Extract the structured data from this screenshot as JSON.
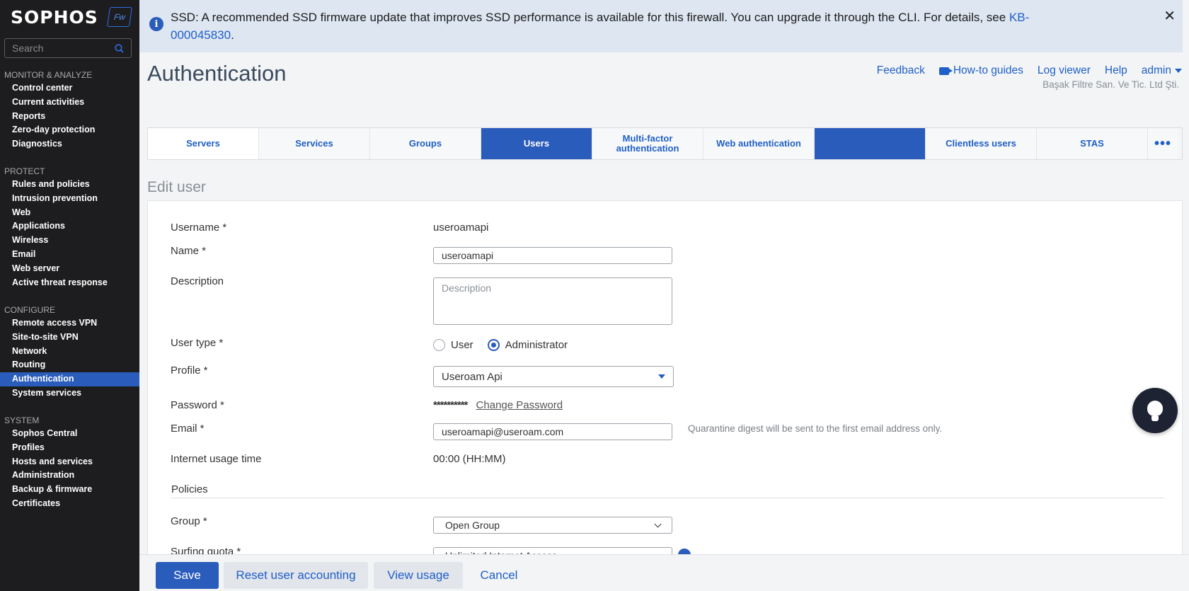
{
  "app": {
    "logo_text": "SOPHOS",
    "logo_badge": "Fw"
  },
  "sidebar": {
    "search_placeholder": "Search",
    "sections": [
      {
        "heading": "MONITOR & ANALYZE",
        "items": [
          "Control center",
          "Current activities",
          "Reports",
          "Zero-day protection",
          "Diagnostics"
        ]
      },
      {
        "heading": "PROTECT",
        "items": [
          "Rules and policies",
          "Intrusion prevention",
          "Web",
          "Applications",
          "Wireless",
          "Email",
          "Web server",
          "Active threat response"
        ]
      },
      {
        "heading": "CONFIGURE",
        "items": [
          "Remote access VPN",
          "Site-to-site VPN",
          "Network",
          "Routing",
          "Authentication",
          "System services"
        ]
      },
      {
        "heading": "SYSTEM",
        "items": [
          "Sophos Central",
          "Profiles",
          "Hosts and services",
          "Administration",
          "Backup & firmware",
          "Certificates"
        ]
      }
    ],
    "active_item": "Authentication"
  },
  "banner": {
    "text": "SSD: A recommended SSD firmware update that improves SSD performance is available for this firewall. You can upgrade it through the CLI. For details, see ",
    "link_text": "KB-000045830",
    "suffix": "."
  },
  "header": {
    "title": "Authentication",
    "links": {
      "feedback": "Feedback",
      "howto": "How-to guides",
      "logviewer": "Log viewer",
      "help": "Help",
      "admin": "admin"
    },
    "org_name": "Başak Filtre San. Ve Tic. Ltd Şti."
  },
  "tabs": [
    {
      "label": "Servers",
      "active": false
    },
    {
      "label": "Services",
      "active": false
    },
    {
      "label": "Groups",
      "active": false
    },
    {
      "label": "Users",
      "active": true
    },
    {
      "label": "Multi-factor authentication",
      "active": false
    },
    {
      "label": "Web authentication",
      "active": false
    },
    {
      "label": "",
      "active": true
    },
    {
      "label": "Clientless users",
      "active": false
    },
    {
      "label": "STAS",
      "active": false
    }
  ],
  "tabs_more": "•••",
  "form": {
    "section_title": "Edit user",
    "username_label": "Username *",
    "username_value": "useroamapi",
    "name_label": "Name *",
    "name_value": "useroamapi",
    "description_label": "Description",
    "description_placeholder": "Description",
    "usertype_label": "User type *",
    "usertype_options": [
      "User",
      "Administrator"
    ],
    "usertype_selected": "Administrator",
    "profile_label": "Profile *",
    "profile_value": "Useroam Api",
    "password_label": "Password *",
    "password_mask": "**********",
    "change_password": "Change Password",
    "email_label": "Email *",
    "email_value": "useroamapi@useroam.com",
    "email_hint": "Quarantine digest will be sent to the first email address only.",
    "internet_label": "Internet usage time",
    "internet_value": "00:00 (HH:MM)",
    "policies_title": "Policies",
    "group_label": "Group *",
    "group_value": "Open Group",
    "surfing_label": "Surfing quota *",
    "surfing_value": "Unlimited Internet Access"
  },
  "footer": {
    "save": "Save",
    "reset": "Reset user accounting",
    "view_usage": "View usage",
    "cancel": "Cancel"
  },
  "colors": {
    "accent": "#2a5cbc",
    "sidebar_bg": "#1d1d1f",
    "banner_bg": "#dde6f1"
  }
}
